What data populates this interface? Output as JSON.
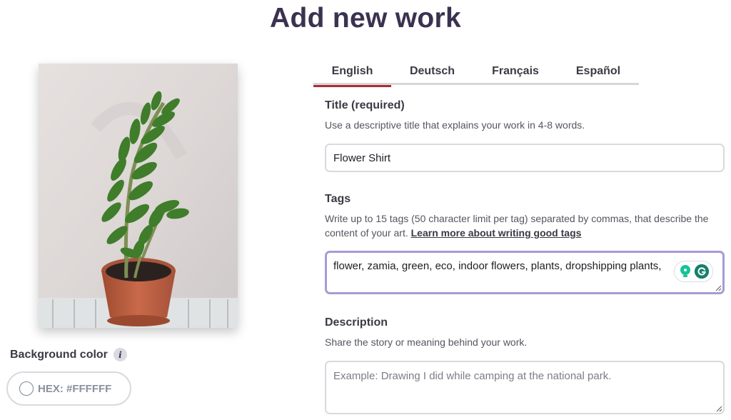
{
  "page": {
    "title": "Add new work"
  },
  "artwork": {
    "alt": "Potted zamia plant against a white textured wall"
  },
  "background_color": {
    "label": "Background color",
    "info_glyph": "i",
    "hex_label": "HEX: #FFFFFF",
    "value": "#FFFFFF"
  },
  "tabs": [
    {
      "label": "English",
      "active": true
    },
    {
      "label": "Deutsch",
      "active": false
    },
    {
      "label": "Français",
      "active": false
    },
    {
      "label": "Español",
      "active": false
    }
  ],
  "form": {
    "title": {
      "label": "Title (required)",
      "help": "Use a descriptive title that explains your work in 4-8 words.",
      "value": "Flower Shirt"
    },
    "tags": {
      "label": "Tags",
      "help": "Write up to 15 tags (50 character limit per tag) separated by commas, that describe the content of your art.",
      "help_link": "Learn more about writing good tags",
      "value": "flower, zamia, green, eco, indoor flowers, plants, dropshipping plants,"
    },
    "description": {
      "label": "Description",
      "help": "Share the story or meaning behind your work.",
      "value": "",
      "placeholder": "Example: Drawing I did while camping at the national park."
    }
  },
  "colors": {
    "accent_tab": "#a72f33",
    "focus_border": "#a99ad6",
    "title_text": "#3b3150",
    "grammarly_green": "#15806a",
    "grammarly_bulb": "#15c39a"
  }
}
